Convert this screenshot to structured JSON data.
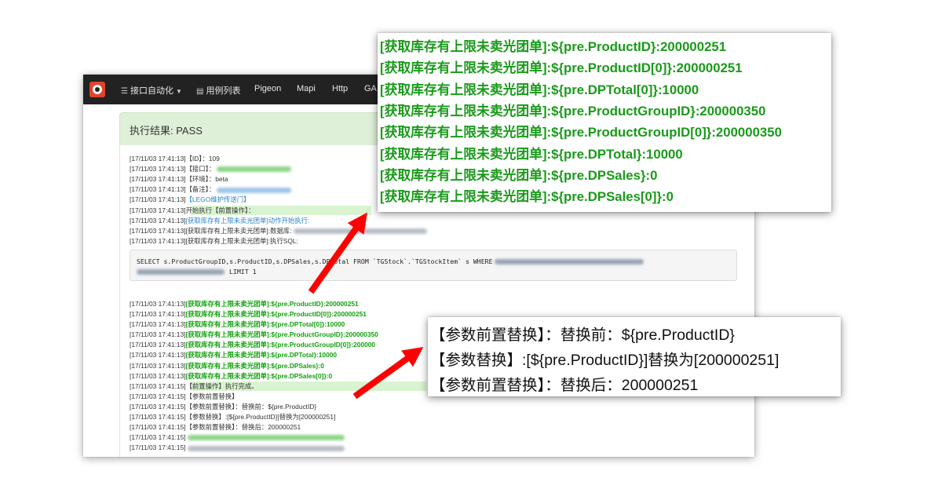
{
  "navbar": {
    "items": [
      {
        "icon": "list-icon",
        "label": "接口自动化",
        "dropdown": true
      },
      {
        "icon": "table-icon",
        "label": "用例列表"
      },
      {
        "label": "Pigeon"
      },
      {
        "label": "Mapi"
      },
      {
        "label": "Http"
      },
      {
        "label": "GA"
      }
    ]
  },
  "result": {
    "title": "执行结果: PASS"
  },
  "log": {
    "lines": [
      {
        "ts": "[17/11/03 17:41:13]",
        "text": "【ID】：109",
        "style": "plain"
      },
      {
        "ts": "[17/11/03 17:41:13]",
        "text": "【接口】：",
        "style": "plain",
        "blurred": "green"
      },
      {
        "ts": "[17/11/03 17:41:13]",
        "text": "【环境】：beta",
        "style": "plain"
      },
      {
        "ts": "[17/11/03 17:41:13]",
        "text": "【备注】：",
        "style": "plain",
        "blurred": "blue"
      },
      {
        "ts": "[17/11/03 17:41:13]",
        "text": "【LEGO维护传送门】",
        "style": "blue"
      },
      {
        "ts": "[17/11/03 17:41:13]",
        "text": "开始执行【前置操作】：",
        "style": "plain",
        "highlight": true
      },
      {
        "ts": "[17/11/03 17:41:13]",
        "text": "[获取库存有上限未卖光团单]动作开始执行:",
        "style": "blue"
      },
      {
        "ts": "[17/11/03 17:41:13]",
        "text": "[获取库存有上限未卖光团单]:数据库:",
        "style": "plain",
        "blurred": "gray"
      },
      {
        "ts": "[17/11/03 17:41:13]",
        "text": "[获取库存有上限未卖光团单]:执行SQL:",
        "style": "plain"
      },
      {
        "ts": "[17/11/03 17:41:13]",
        "text": "[获取库存有上限未卖光团单]:${pre.ProductID}:200000251",
        "style": "green"
      },
      {
        "ts": "[17/11/03 17:41:13]",
        "text": "[获取库存有上限未卖光团单]:${pre.ProductID[0]}:200000251",
        "style": "green"
      },
      {
        "ts": "[17/11/03 17:41:13]",
        "text": "[获取库存有上限未卖光团单]:${pre.DPTotal[0]}:10000",
        "style": "green"
      },
      {
        "ts": "[17/11/03 17:41:13]",
        "text": "[获取库存有上限未卖光团单]:${pre.ProductGroupID}:200000350",
        "style": "green"
      },
      {
        "ts": "[17/11/03 17:41:13]",
        "text": "[获取库存有上限未卖光团单]:${pre.ProductGroupID[0]}:200000",
        "style": "green"
      },
      {
        "ts": "[17/11/03 17:41:13]",
        "text": "[获取库存有上限未卖光团单]:${pre.DPTotal}:10000",
        "style": "green"
      },
      {
        "ts": "[17/11/03 17:41:13]",
        "text": "[获取库存有上限未卖光团单]:${pre.DPSales}:0",
        "style": "green"
      },
      {
        "ts": "[17/11/03 17:41:13]",
        "text": "[获取库存有上限未卖光团单]:${pre.DPSales[0]}:0",
        "style": "green"
      },
      {
        "ts": "[17/11/03 17:41:15]",
        "text": "【前置操作】执行完成。",
        "style": "plain",
        "highlight": true
      },
      {
        "ts": "[17/11/03 17:41:15]",
        "text": "【参数前置替换】",
        "style": "plain"
      },
      {
        "ts": "[17/11/03 17:41:15]",
        "text": "【参数前置替换】：替换前：${pre.ProductID}",
        "style": "plain"
      },
      {
        "ts": "[17/11/03 17:41:15]",
        "text": "【参数替换】:[${pre.ProductID}]替换为[200000251]",
        "style": "plain"
      },
      {
        "ts": "[17/11/03 17:41:15]",
        "text": "【参数前置替换】：替换后：200000251",
        "style": "plain"
      },
      {
        "ts": "[17/11/03 17:41:15]",
        "text": "",
        "style": "plain",
        "blurred": "green"
      },
      {
        "ts": "[17/11/03 17:41:15]",
        "text": "",
        "style": "plain",
        "blurred": "gray"
      }
    ]
  },
  "sql": {
    "line1": "SELECT s.ProductGroupID,s.ProductID,s.DPSales,s.DPTotal FROM `TGStock`.`TGStockItem` s WHERE",
    "line2": "LIMIT 1"
  },
  "callout_top": {
    "lines": [
      "[获取库存有上限未卖光团单]:${pre.ProductID}:200000251",
      "[获取库存有上限未卖光团单]:${pre.ProductID[0]}:200000251",
      "[获取库存有上限未卖光团单]:${pre.DPTotal[0]}:10000",
      "[获取库存有上限未卖光团单]:${pre.ProductGroupID}:200000350",
      "[获取库存有上限未卖光团单]:${pre.ProductGroupID[0]}:200000350",
      "[获取库存有上限未卖光团单]:${pre.DPTotal}:10000",
      "[获取库存有上限未卖光团单]:${pre.DPSales}:0",
      "[获取库存有上限未卖光团单]:${pre.DPSales[0]}:0"
    ]
  },
  "callout_bottom": {
    "lines": [
      "【参数前置替换】：替换前：${pre.ProductID}",
      "【参数替换】:[${pre.ProductID}]替换为[200000251]",
      "【参数前置替换】：替换后：200000251"
    ]
  },
  "colors": {
    "navbar_bg": "#222222",
    "success_bg": "#dff0d8",
    "log_green": "#13a10e",
    "log_blue": "#2b83c9",
    "arrow_red": "#ff0000",
    "logo_red": "#e0442b"
  }
}
